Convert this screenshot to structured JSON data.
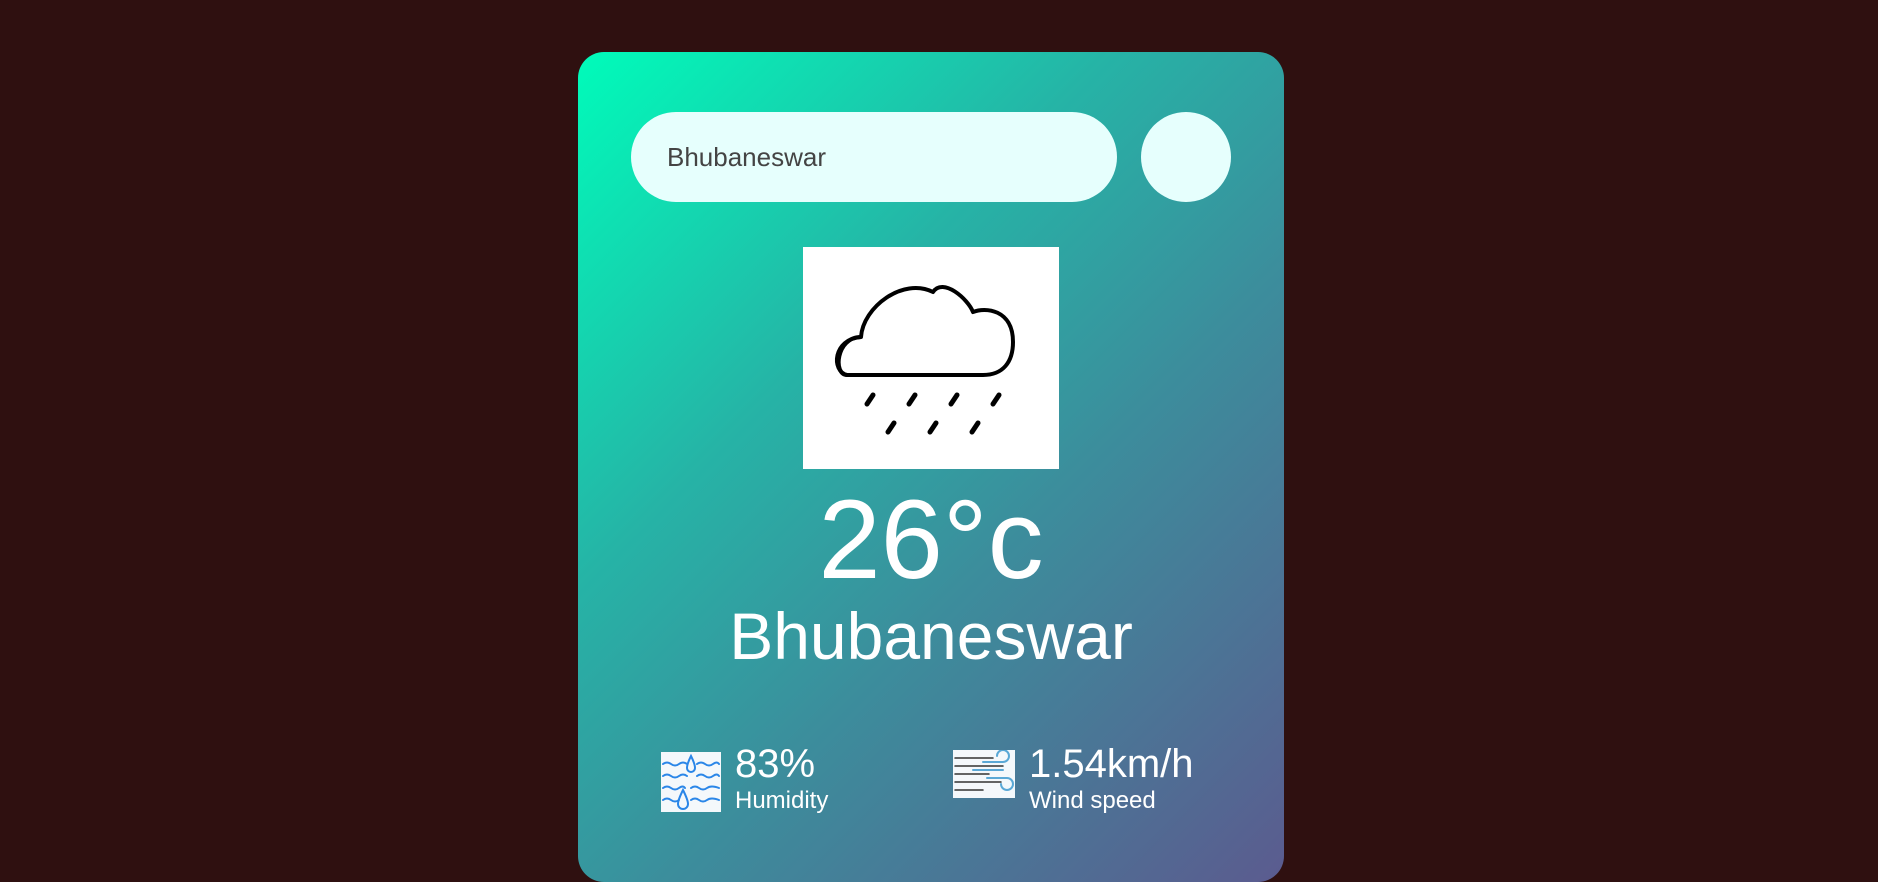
{
  "search": {
    "value": "Bhubaneswar",
    "button_icon": "search-icon"
  },
  "weather": {
    "icon": "rain-cloud-icon",
    "temperature": "26°c",
    "city": "Bhubaneswar"
  },
  "details": {
    "humidity": {
      "value": "83%",
      "label": "Humidity",
      "icon": "humidity-icon"
    },
    "wind": {
      "value": "1.54km/h",
      "label": "Wind speed",
      "icon": "wind-icon"
    }
  },
  "colors": {
    "page_background": "#2f1010",
    "card_gradient_start": "#00fcba",
    "card_gradient_end": "#5b5b8f",
    "search_background": "#e6fffd",
    "text": "#ffffff"
  }
}
